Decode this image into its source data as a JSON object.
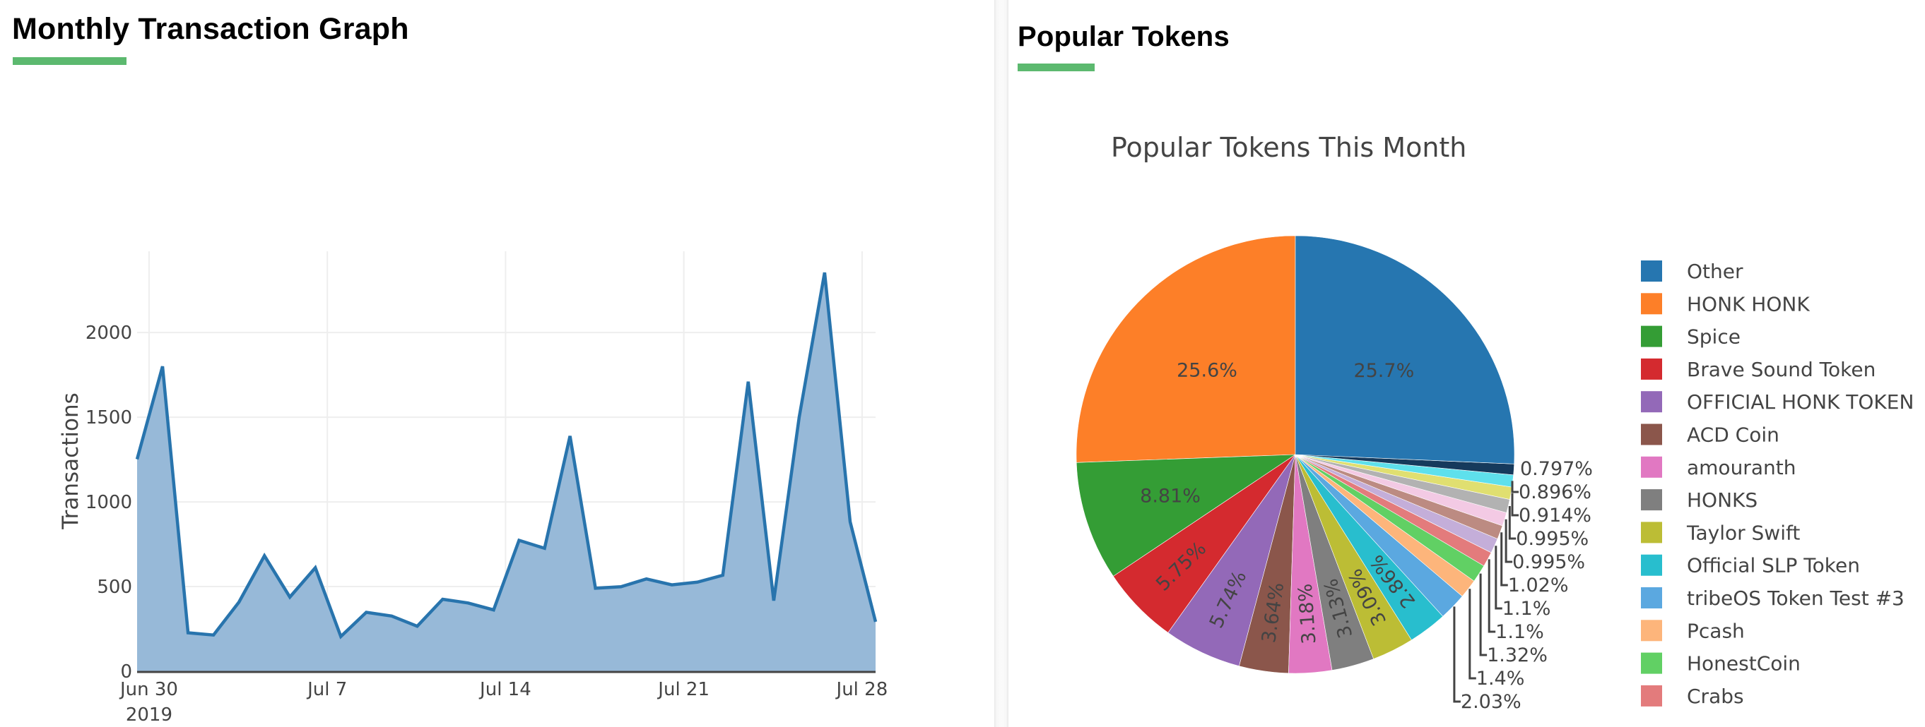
{
  "left_panel": {
    "title": "Monthly Transaction Graph"
  },
  "right_panel": {
    "title": "Popular Tokens"
  },
  "colors": {
    "accent": "#5cb96f",
    "line": "#2874ad",
    "fill": "#97b9d8"
  },
  "chart_data": [
    {
      "type": "area",
      "title": "",
      "xlabel": "",
      "ylabel": "Transactions",
      "x_start": "2019-06-29",
      "x_tick_labels": [
        "Jun 30",
        "Jul 7",
        "Jul 14",
        "Jul 21",
        "Jul 28"
      ],
      "x_tick_days": [
        1,
        8,
        15,
        22,
        29
      ],
      "x_year_label": "2019",
      "y_ticks": [
        0,
        500,
        1000,
        1500,
        2000
      ],
      "ylim": [
        0,
        2480
      ],
      "x_day_range": [
        0.53,
        29.53
      ],
      "grid": true,
      "series": [
        {
          "name": "Transactions",
          "values": [
            1252,
            1800,
            227,
            214,
            408,
            682,
            438,
            611,
            205,
            348,
            326,
            266,
            425,
            403,
            362,
            773,
            726,
            1389,
            490,
            499,
            545,
            510,
            526,
            567,
            1710,
            417,
            1500,
            2354,
            883,
            292
          ]
        }
      ]
    },
    {
      "type": "pie",
      "title": "Popular Tokens This Month",
      "direction": "counterclockwise",
      "start": "top",
      "legend_position": "right",
      "slices": [
        {
          "label": "HONK HONK",
          "percent": 25.6,
          "color": "#fd7f28",
          "text": "25.6%",
          "textpos": "inside-horizontal",
          "legend": true
        },
        {
          "label": "Spice",
          "percent": 8.81,
          "color": "#349d35",
          "text": "8.81%",
          "textpos": "inside-horizontal",
          "legend": true
        },
        {
          "label": "Brave Sound Token",
          "percent": 5.75,
          "color": "#d42a2f",
          "text": "5.75%",
          "textpos": "inside-radial",
          "legend": true
        },
        {
          "label": "OFFICIAL HONK TOKEN",
          "percent": 5.74,
          "color": "#9369b8",
          "text": "5.74%",
          "textpos": "inside-radial",
          "legend": true
        },
        {
          "label": "ACD Coin",
          "percent": 3.64,
          "color": "#8b564b",
          "text": "3.64%",
          "textpos": "inside-radial",
          "legend": true
        },
        {
          "label": "amouranth",
          "percent": 3.18,
          "color": "#e178c2",
          "text": "3.18%",
          "textpos": "inside-radial",
          "legend": true
        },
        {
          "label": "HONKS",
          "percent": 3.13,
          "color": "#7f7f7f",
          "text": "3.13%",
          "textpos": "inside-radial",
          "legend": true
        },
        {
          "label": "Taylor Swift",
          "percent": 3.09,
          "color": "#bcbd35",
          "text": "3.09%",
          "textpos": "inside-radial",
          "legend": true
        },
        {
          "label": "Official SLP Token",
          "percent": 2.86,
          "color": "#28bece",
          "text": "2.86%",
          "textpos": "inside-radial",
          "legend": true
        },
        {
          "label": "tribeOS Token Test #3",
          "percent": 2.03,
          "color": "#5ba8e0",
          "text": "2.03%",
          "textpos": "outside",
          "legend": true
        },
        {
          "label": "Pcash",
          "percent": 1.4,
          "color": "#fdb57b",
          "text": "1.4%",
          "textpos": "outside",
          "legend": true
        },
        {
          "label": "HonestCoin",
          "percent": 1.32,
          "color": "#61d064",
          "text": "1.32%",
          "textpos": "outside",
          "legend": true
        },
        {
          "label": "Crabs",
          "percent": 1.1,
          "color": "#e37b7c",
          "text": "1.1%",
          "textpos": "outside",
          "legend": true
        },
        {
          "label": "",
          "percent": 1.1,
          "color": "#c4aed9",
          "text": "1.1%",
          "textpos": "outside",
          "legend": false
        },
        {
          "label": "",
          "percent": 1.02,
          "color": "#bc8b82",
          "text": "1.02%",
          "textpos": "outside",
          "legend": false
        },
        {
          "label": "",
          "percent": 0.995,
          "color": "#f3cae4",
          "text": "0.995%",
          "textpos": "outside",
          "legend": false
        },
        {
          "label": "",
          "percent": 0.995,
          "color": "#b2b2b2",
          "text": "0.995%",
          "textpos": "outside",
          "legend": false
        },
        {
          "label": "",
          "percent": 0.914,
          "color": "#e0df70",
          "text": "0.914%",
          "textpos": "outside",
          "legend": false
        },
        {
          "label": "",
          "percent": 0.896,
          "color": "#5ee0ec",
          "text": "0.896%",
          "textpos": "outside",
          "legend": false
        },
        {
          "label": "",
          "percent": 0.797,
          "color": "#163a5c",
          "text": "0.797%",
          "textpos": "outside",
          "legend": false
        },
        {
          "label": "Other",
          "percent": 25.7,
          "color": "#2676b0",
          "text": "25.7%",
          "textpos": "inside-horizontal",
          "legend": true
        }
      ],
      "legend": [
        "Other",
        "HONK HONK",
        "Spice",
        "Brave Sound Token",
        "OFFICIAL HONK TOKEN",
        "ACD Coin",
        "amouranth",
        "HONKS",
        "Taylor Swift",
        "Official SLP Token",
        "tribeOS Token Test #3",
        "Pcash",
        "HonestCoin",
        "Crabs"
      ]
    }
  ]
}
